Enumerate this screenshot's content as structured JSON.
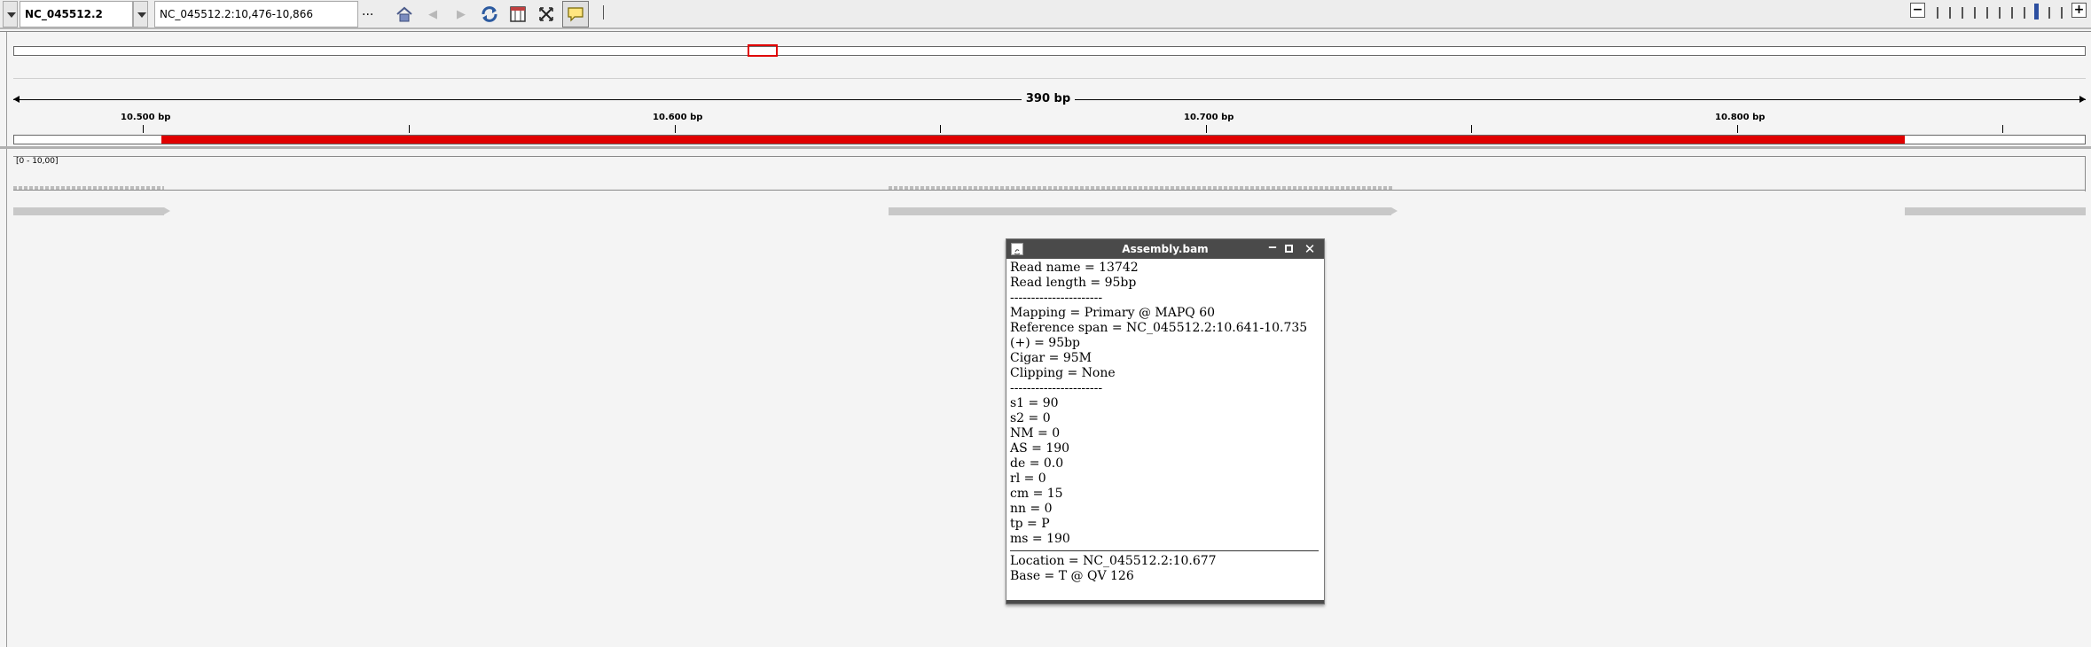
{
  "toolbar": {
    "chromosome": "NC_045512.2",
    "locus": "NC_045512.2:10,476-10,866",
    "more_label": "...",
    "icons": [
      "home-icon",
      "back-icon",
      "forward-icon",
      "refresh-icon",
      "region-icon",
      "close-icon",
      "popup-icon",
      "divider"
    ]
  },
  "ruler": {
    "span_label": "390 bp",
    "ticks": [
      "10.500 bp",
      "10.600 bp",
      "10.700 bp",
      "10.800 bp"
    ],
    "annotation_color": "#e00000"
  },
  "track": {
    "data_range": "[0 - 10,00]"
  },
  "popup": {
    "title": "Assembly.bam",
    "lines_block1": [
      "Read name = 13742",
      "Read length = 95bp",
      "----------------------",
      "Mapping = Primary @ MAPQ 60",
      "Reference span = NC_045512.2:10.641-10.735",
      "(+) = 95bp",
      "Cigar = 95M",
      "Clipping = None",
      "----------------------",
      "s1 = 90",
      "s2 = 0",
      "NM = 0",
      "AS = 190",
      "de = 0.0",
      "rl = 0",
      "cm = 15",
      "nn = 0",
      "tp = P",
      "ms = 190"
    ],
    "lines_block2": [
      "Location = NC_045512.2:10.677",
      "Base = T @ QV 126"
    ]
  }
}
